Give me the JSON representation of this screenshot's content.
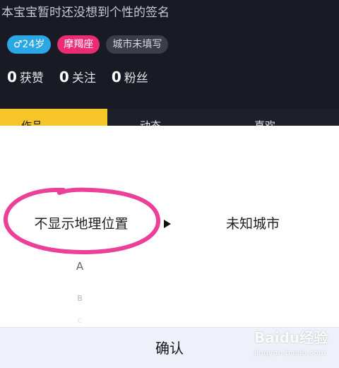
{
  "profile": {
    "signature": "本宝宝暂时还没想到个性的签名",
    "tags": {
      "age": "♂24岁",
      "zodiac": "摩羯座",
      "city": "城市未填写"
    },
    "stats": {
      "likes_count": "0",
      "likes_label": "获赞",
      "following_count": "0",
      "following_label": "关注",
      "followers_count": "0",
      "followers_label": "粉丝"
    }
  },
  "tabs": {
    "tab1": "作品",
    "tab2": "动态",
    "tab3": "喜欢"
  },
  "picker": {
    "left_selected": "不显示地理位置",
    "right_selected": "未知城市",
    "letters": [
      "A",
      "B",
      "C"
    ],
    "confirm_label": "确认"
  },
  "watermark": {
    "main": "Baidu经验",
    "sub": "jingyan.baidu.com"
  },
  "colors": {
    "highlight": "#ec3f9a",
    "active_tab": "#f6c629",
    "age_tag": "#2ba7e6",
    "zodiac_tag": "#ec2b75"
  }
}
